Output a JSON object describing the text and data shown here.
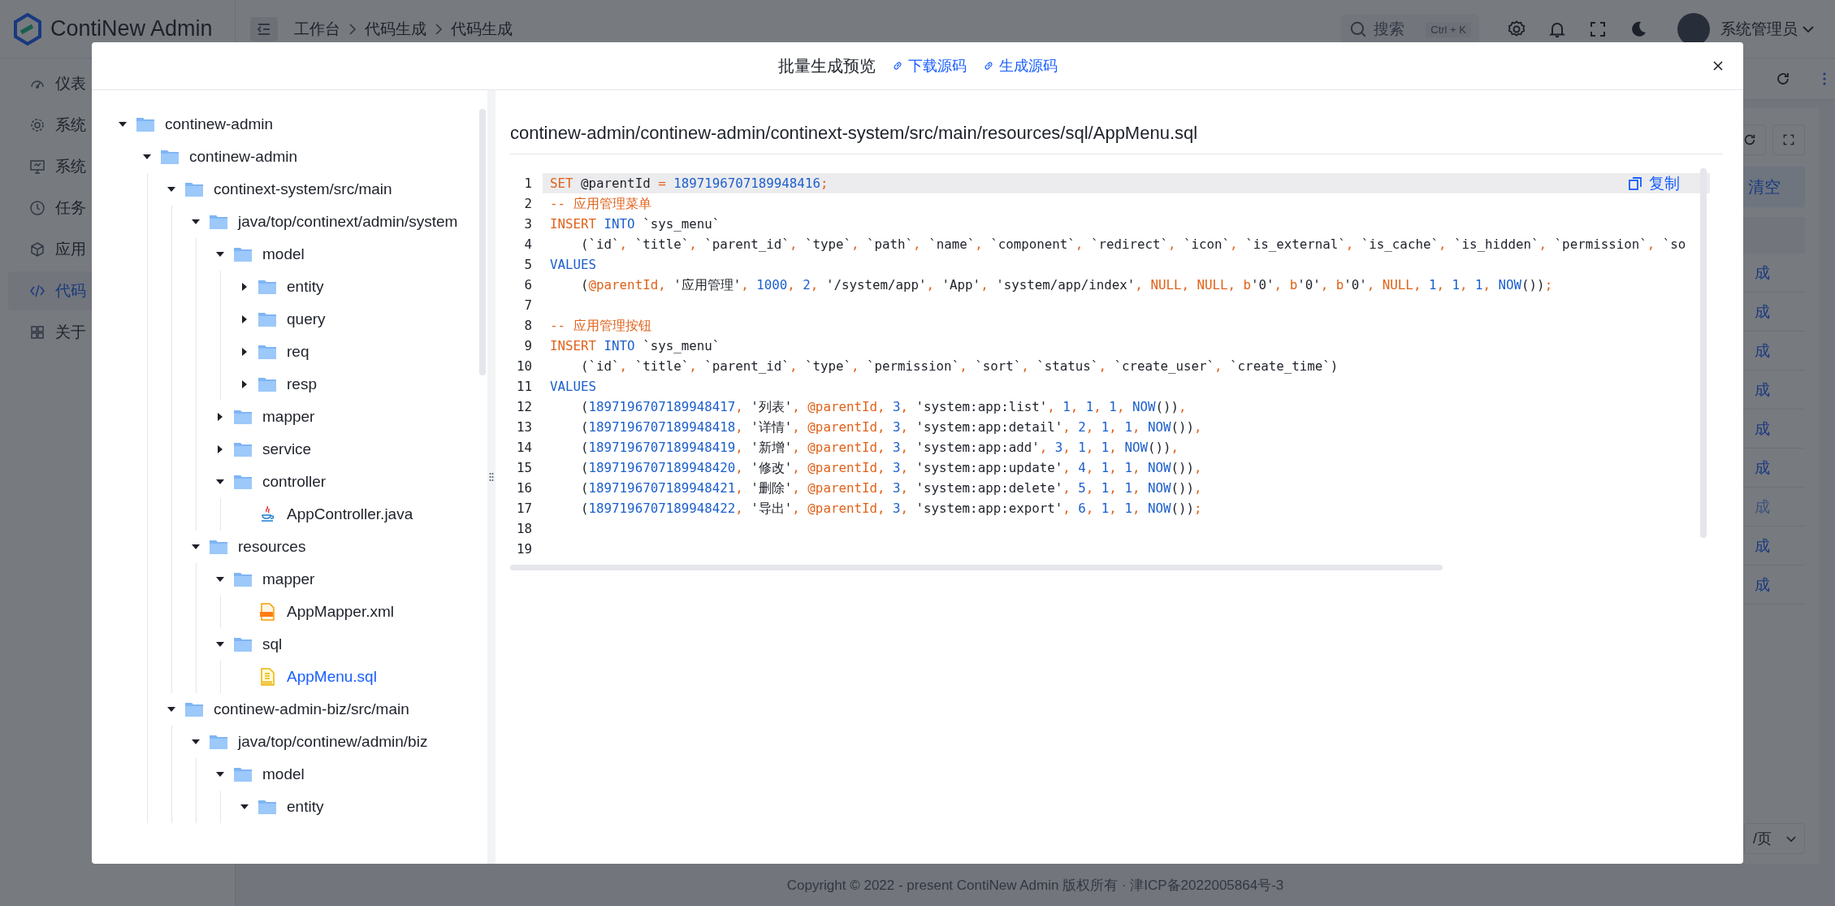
{
  "header": {
    "logo": "ContiNew Admin",
    "breadcrumb": [
      "工作台",
      "代码生成",
      "代码生成"
    ],
    "search": {
      "placeholder": "搜索",
      "shortcut": "Ctrl + K"
    },
    "user": "系统管理员"
  },
  "sidebar": {
    "items": [
      {
        "label": "仪表",
        "selected": false
      },
      {
        "label": "系统",
        "selected": false
      },
      {
        "label": "系统",
        "selected": false
      },
      {
        "label": "任务",
        "selected": false
      },
      {
        "label": "应用",
        "selected": false
      },
      {
        "label": "代码",
        "selected": true
      },
      {
        "label": "关于",
        "selected": false
      }
    ]
  },
  "page": {
    "clear_button": "清空",
    "rows": [
      {
        "text": "成",
        "disabled": false
      },
      {
        "text": "成",
        "disabled": false
      },
      {
        "text": "成",
        "disabled": false
      },
      {
        "text": "成",
        "disabled": false
      },
      {
        "text": "成",
        "disabled": false
      },
      {
        "text": "成",
        "disabled": false
      },
      {
        "text": "成",
        "disabled": true
      },
      {
        "text": "成",
        "disabled": false
      },
      {
        "text": "成",
        "disabled": false
      }
    ],
    "pagination": "/页",
    "footer": "Copyright © 2022 - present ContiNew Admin 版权所有 · 津ICP备2022005864号-3"
  },
  "modal": {
    "title": "批量生成预览",
    "links": [
      "下载源码",
      "生成源码"
    ],
    "tree": [
      {
        "name": "continew-admin",
        "kind": "folder",
        "expanded": true,
        "selected": false,
        "children": [
          {
            "name": "continew-admin",
            "kind": "folder",
            "expanded": true,
            "selected": false,
            "children": [
              {
                "name": "continext-system/src/main",
                "kind": "folder",
                "expanded": true,
                "selected": false,
                "children": [
                  {
                    "name": "java/top/continext/admin/system",
                    "kind": "folder",
                    "expanded": true,
                    "selected": false,
                    "children": [
                      {
                        "name": "model",
                        "kind": "folder",
                        "expanded": true,
                        "selected": false,
                        "children": [
                          {
                            "name": "entity",
                            "kind": "folder",
                            "expanded": false,
                            "selected": false
                          },
                          {
                            "name": "query",
                            "kind": "folder",
                            "expanded": false,
                            "selected": false
                          },
                          {
                            "name": "req",
                            "kind": "folder",
                            "expanded": false,
                            "selected": false
                          },
                          {
                            "name": "resp",
                            "kind": "folder",
                            "expanded": false,
                            "selected": false
                          }
                        ]
                      },
                      {
                        "name": "mapper",
                        "kind": "folder",
                        "expanded": false,
                        "selected": false
                      },
                      {
                        "name": "service",
                        "kind": "folder",
                        "expanded": false,
                        "selected": false
                      },
                      {
                        "name": "controller",
                        "kind": "folder",
                        "expanded": true,
                        "selected": false,
                        "children": [
                          {
                            "name": "AppController.java",
                            "kind": "java",
                            "selected": false
                          }
                        ]
                      }
                    ]
                  },
                  {
                    "name": "resources",
                    "kind": "folder",
                    "expanded": true,
                    "selected": false,
                    "children": [
                      {
                        "name": "mapper",
                        "kind": "folder",
                        "expanded": true,
                        "selected": false,
                        "children": [
                          {
                            "name": "AppMapper.xml",
                            "kind": "xml",
                            "selected": false
                          }
                        ]
                      },
                      {
                        "name": "sql",
                        "kind": "folder",
                        "expanded": true,
                        "selected": false,
                        "children": [
                          {
                            "name": "AppMenu.sql",
                            "kind": "sql",
                            "selected": true
                          }
                        ]
                      }
                    ]
                  }
                ]
              },
              {
                "name": "continew-admin-biz/src/main",
                "kind": "folder",
                "expanded": true,
                "selected": false,
                "children": [
                  {
                    "name": "java/top/continew/admin/biz",
                    "kind": "folder",
                    "expanded": true,
                    "selected": false,
                    "children": [
                      {
                        "name": "model",
                        "kind": "folder",
                        "expanded": true,
                        "selected": false,
                        "children": [
                          {
                            "name": "entity",
                            "kind": "folder",
                            "expanded": true,
                            "selected": false
                          }
                        ]
                      }
                    ]
                  }
                ]
              }
            ]
          }
        ]
      }
    ],
    "file_path": "continew-admin/continew-admin/continext-system/src/main/resources/sql/AppMenu.sql",
    "copy_button": "复制",
    "code": [
      {
        "no": "1",
        "active": true,
        "tokens": [
          {
            "t": "SET",
            "kind": "keyword"
          },
          {
            "t": " @parentId ",
            "kind": "plain"
          },
          {
            "t": "=",
            "kind": "punct"
          },
          {
            "t": " 1897196707189948416",
            "kind": "number"
          },
          {
            "t": ";",
            "kind": "punct"
          }
        ]
      },
      {
        "no": "2",
        "active": false,
        "tokens": [
          {
            "t": "-- 应用管理菜单",
            "kind": "comment"
          }
        ]
      },
      {
        "no": "3",
        "active": false,
        "tokens": [
          {
            "t": "INSERT",
            "kind": "keyword"
          },
          {
            "t": " INTO",
            "kind": "function"
          },
          {
            "t": " `sys_menu`",
            "kind": "plain"
          }
        ]
      },
      {
        "no": "4",
        "active": false,
        "tokens": [
          {
            "t": "    (`id`",
            "kind": "plain"
          },
          {
            "t": ", ",
            "kind": "punct"
          },
          {
            "t": "`title`",
            "kind": "plain"
          },
          {
            "t": ", ",
            "kind": "punct"
          },
          {
            "t": "`parent_id`",
            "kind": "plain"
          },
          {
            "t": ", ",
            "kind": "punct"
          },
          {
            "t": "`type`",
            "kind": "plain"
          },
          {
            "t": ", ",
            "kind": "punct"
          },
          {
            "t": "`path`",
            "kind": "plain"
          },
          {
            "t": ", ",
            "kind": "punct"
          },
          {
            "t": "`name`",
            "kind": "plain"
          },
          {
            "t": ", ",
            "kind": "punct"
          },
          {
            "t": "`component`",
            "kind": "plain"
          },
          {
            "t": ", ",
            "kind": "punct"
          },
          {
            "t": "`redirect`",
            "kind": "plain"
          },
          {
            "t": ", ",
            "kind": "punct"
          },
          {
            "t": "`icon`",
            "kind": "plain"
          },
          {
            "t": ", ",
            "kind": "punct"
          },
          {
            "t": "`is_external`",
            "kind": "plain"
          },
          {
            "t": ", ",
            "kind": "punct"
          },
          {
            "t": "`is_cache`",
            "kind": "plain"
          },
          {
            "t": ", ",
            "kind": "punct"
          },
          {
            "t": "`is_hidden`",
            "kind": "plain"
          },
          {
            "t": ", ",
            "kind": "punct"
          },
          {
            "t": "`permission`",
            "kind": "plain"
          },
          {
            "t": ", ",
            "kind": "punct"
          },
          {
            "t": "`so",
            "kind": "plain"
          }
        ]
      },
      {
        "no": "5",
        "active": false,
        "tokens": [
          {
            "t": "VALUES",
            "kind": "function"
          }
        ]
      },
      {
        "no": "6",
        "active": false,
        "tokens": [
          {
            "t": "    (",
            "kind": "plain"
          },
          {
            "t": "@parentId",
            "kind": "variable"
          },
          {
            "t": ", ",
            "kind": "punct"
          },
          {
            "t": "'应用管理'",
            "kind": "string"
          },
          {
            "t": ", ",
            "kind": "punct"
          },
          {
            "t": "1000",
            "kind": "number"
          },
          {
            "t": ", ",
            "kind": "punct"
          },
          {
            "t": "2",
            "kind": "number"
          },
          {
            "t": ", ",
            "kind": "punct"
          },
          {
            "t": "'/system/app'",
            "kind": "string"
          },
          {
            "t": ", ",
            "kind": "punct"
          },
          {
            "t": "'App'",
            "kind": "string"
          },
          {
            "t": ", ",
            "kind": "punct"
          },
          {
            "t": "'system/app/index'",
            "kind": "string"
          },
          {
            "t": ", ",
            "kind": "punct"
          },
          {
            "t": "NULL",
            "kind": "keyword"
          },
          {
            "t": ", ",
            "kind": "punct"
          },
          {
            "t": "NULL",
            "kind": "keyword"
          },
          {
            "t": ", ",
            "kind": "punct"
          },
          {
            "t": "b",
            "kind": "keyword"
          },
          {
            "t": "'0'",
            "kind": "string"
          },
          {
            "t": ", ",
            "kind": "punct"
          },
          {
            "t": "b",
            "kind": "keyword"
          },
          {
            "t": "'0'",
            "kind": "string"
          },
          {
            "t": ", ",
            "kind": "punct"
          },
          {
            "t": "b",
            "kind": "keyword"
          },
          {
            "t": "'0'",
            "kind": "string"
          },
          {
            "t": ", ",
            "kind": "punct"
          },
          {
            "t": "NULL",
            "kind": "keyword"
          },
          {
            "t": ", ",
            "kind": "punct"
          },
          {
            "t": "1",
            "kind": "number"
          },
          {
            "t": ", ",
            "kind": "punct"
          },
          {
            "t": "1",
            "kind": "number"
          },
          {
            "t": ", ",
            "kind": "punct"
          },
          {
            "t": "1",
            "kind": "number"
          },
          {
            "t": ", ",
            "kind": "punct"
          },
          {
            "t": "NOW",
            "kind": "function"
          },
          {
            "t": "())",
            "kind": "plain"
          },
          {
            "t": ";",
            "kind": "punct"
          }
        ]
      },
      {
        "no": "7",
        "active": false
      },
      {
        "no": "8",
        "active": false,
        "tokens": [
          {
            "t": "-- 应用管理按钮",
            "kind": "comment"
          }
        ]
      },
      {
        "no": "9",
        "active": false,
        "tokens": [
          {
            "t": "INSERT",
            "kind": "keyword"
          },
          {
            "t": " INTO",
            "kind": "function"
          },
          {
            "t": " `sys_menu`",
            "kind": "plain"
          }
        ]
      },
      {
        "no": "10",
        "active": false,
        "tokens": [
          {
            "t": "    (`id`",
            "kind": "plain"
          },
          {
            "t": ", ",
            "kind": "punct"
          },
          {
            "t": "`title`",
            "kind": "plain"
          },
          {
            "t": ", ",
            "kind": "punct"
          },
          {
            "t": "`parent_id`",
            "kind": "plain"
          },
          {
            "t": ", ",
            "kind": "punct"
          },
          {
            "t": "`type`",
            "kind": "plain"
          },
          {
            "t": ", ",
            "kind": "punct"
          },
          {
            "t": "`permission`",
            "kind": "plain"
          },
          {
            "t": ", ",
            "kind": "punct"
          },
          {
            "t": "`sort`",
            "kind": "plain"
          },
          {
            "t": ", ",
            "kind": "punct"
          },
          {
            "t": "`status`",
            "kind": "plain"
          },
          {
            "t": ", ",
            "kind": "punct"
          },
          {
            "t": "`create_user`",
            "kind": "plain"
          },
          {
            "t": ", ",
            "kind": "punct"
          },
          {
            "t": "`create_time`)",
            "kind": "plain"
          }
        ]
      },
      {
        "no": "11",
        "active": false,
        "tokens": [
          {
            "t": "VALUES",
            "kind": "function"
          }
        ]
      },
      {
        "no": "12",
        "active": false,
        "tokens": [
          {
            "t": "    (",
            "kind": "plain"
          },
          {
            "t": "1897196707189948417",
            "kind": "number"
          },
          {
            "t": ", ",
            "kind": "punct"
          },
          {
            "t": "'列表'",
            "kind": "string"
          },
          {
            "t": ", ",
            "kind": "punct"
          },
          {
            "t": "@parentId",
            "kind": "variable"
          },
          {
            "t": ", ",
            "kind": "punct"
          },
          {
            "t": "3",
            "kind": "number"
          },
          {
            "t": ", ",
            "kind": "punct"
          },
          {
            "t": "'system:app:list'",
            "kind": "string"
          },
          {
            "t": ", ",
            "kind": "punct"
          },
          {
            "t": "1",
            "kind": "number"
          },
          {
            "t": ", ",
            "kind": "punct"
          },
          {
            "t": "1",
            "kind": "number"
          },
          {
            "t": ", ",
            "kind": "punct"
          },
          {
            "t": "1",
            "kind": "number"
          },
          {
            "t": ", ",
            "kind": "punct"
          },
          {
            "t": "NOW",
            "kind": "function"
          },
          {
            "t": "())",
            "kind": "plain"
          },
          {
            "t": ",",
            "kind": "punct"
          }
        ]
      },
      {
        "no": "13",
        "active": false,
        "tokens": [
          {
            "t": "    (",
            "kind": "plain"
          },
          {
            "t": "1897196707189948418",
            "kind": "number"
          },
          {
            "t": ", ",
            "kind": "punct"
          },
          {
            "t": "'详情'",
            "kind": "string"
          },
          {
            "t": ", ",
            "kind": "punct"
          },
          {
            "t": "@parentId",
            "kind": "variable"
          },
          {
            "t": ", ",
            "kind": "punct"
          },
          {
            "t": "3",
            "kind": "number"
          },
          {
            "t": ", ",
            "kind": "punct"
          },
          {
            "t": "'system:app:detail'",
            "kind": "string"
          },
          {
            "t": ", ",
            "kind": "punct"
          },
          {
            "t": "2",
            "kind": "number"
          },
          {
            "t": ", ",
            "kind": "punct"
          },
          {
            "t": "1",
            "kind": "number"
          },
          {
            "t": ", ",
            "kind": "punct"
          },
          {
            "t": "1",
            "kind": "number"
          },
          {
            "t": ", ",
            "kind": "punct"
          },
          {
            "t": "NOW",
            "kind": "function"
          },
          {
            "t": "())",
            "kind": "plain"
          },
          {
            "t": ",",
            "kind": "punct"
          }
        ]
      },
      {
        "no": "14",
        "active": false,
        "tokens": [
          {
            "t": "    (",
            "kind": "plain"
          },
          {
            "t": "1897196707189948419",
            "kind": "number"
          },
          {
            "t": ", ",
            "kind": "punct"
          },
          {
            "t": "'新增'",
            "kind": "string"
          },
          {
            "t": ", ",
            "kind": "punct"
          },
          {
            "t": "@parentId",
            "kind": "variable"
          },
          {
            "t": ", ",
            "kind": "punct"
          },
          {
            "t": "3",
            "kind": "number"
          },
          {
            "t": ", ",
            "kind": "punct"
          },
          {
            "t": "'system:app:add'",
            "kind": "string"
          },
          {
            "t": ", ",
            "kind": "punct"
          },
          {
            "t": "3",
            "kind": "number"
          },
          {
            "t": ", ",
            "kind": "punct"
          },
          {
            "t": "1",
            "kind": "number"
          },
          {
            "t": ", ",
            "kind": "punct"
          },
          {
            "t": "1",
            "kind": "number"
          },
          {
            "t": ", ",
            "kind": "punct"
          },
          {
            "t": "NOW",
            "kind": "function"
          },
          {
            "t": "())",
            "kind": "plain"
          },
          {
            "t": ",",
            "kind": "punct"
          }
        ]
      },
      {
        "no": "15",
        "active": false,
        "tokens": [
          {
            "t": "    (",
            "kind": "plain"
          },
          {
            "t": "1897196707189948420",
            "kind": "number"
          },
          {
            "t": ", ",
            "kind": "punct"
          },
          {
            "t": "'修改'",
            "kind": "string"
          },
          {
            "t": ", ",
            "kind": "punct"
          },
          {
            "t": "@parentId",
            "kind": "variable"
          },
          {
            "t": ", ",
            "kind": "punct"
          },
          {
            "t": "3",
            "kind": "number"
          },
          {
            "t": ", ",
            "kind": "punct"
          },
          {
            "t": "'system:app:update'",
            "kind": "string"
          },
          {
            "t": ", ",
            "kind": "punct"
          },
          {
            "t": "4",
            "kind": "number"
          },
          {
            "t": ", ",
            "kind": "punct"
          },
          {
            "t": "1",
            "kind": "number"
          },
          {
            "t": ", ",
            "kind": "punct"
          },
          {
            "t": "1",
            "kind": "number"
          },
          {
            "t": ", ",
            "kind": "punct"
          },
          {
            "t": "NOW",
            "kind": "function"
          },
          {
            "t": "())",
            "kind": "plain"
          },
          {
            "t": ",",
            "kind": "punct"
          }
        ]
      },
      {
        "no": "16",
        "active": false,
        "tokens": [
          {
            "t": "    (",
            "kind": "plain"
          },
          {
            "t": "1897196707189948421",
            "kind": "number"
          },
          {
            "t": ", ",
            "kind": "punct"
          },
          {
            "t": "'删除'",
            "kind": "string"
          },
          {
            "t": ", ",
            "kind": "punct"
          },
          {
            "t": "@parentId",
            "kind": "variable"
          },
          {
            "t": ", ",
            "kind": "punct"
          },
          {
            "t": "3",
            "kind": "number"
          },
          {
            "t": ", ",
            "kind": "punct"
          },
          {
            "t": "'system:app:delete'",
            "kind": "string"
          },
          {
            "t": ", ",
            "kind": "punct"
          },
          {
            "t": "5",
            "kind": "number"
          },
          {
            "t": ", ",
            "kind": "punct"
          },
          {
            "t": "1",
            "kind": "number"
          },
          {
            "t": ", ",
            "kind": "punct"
          },
          {
            "t": "1",
            "kind": "number"
          },
          {
            "t": ", ",
            "kind": "punct"
          },
          {
            "t": "NOW",
            "kind": "function"
          },
          {
            "t": "())",
            "kind": "plain"
          },
          {
            "t": ",",
            "kind": "punct"
          }
        ]
      },
      {
        "no": "17",
        "active": false,
        "tokens": [
          {
            "t": "    (",
            "kind": "plain"
          },
          {
            "t": "1897196707189948422",
            "kind": "number"
          },
          {
            "t": ", ",
            "kind": "punct"
          },
          {
            "t": "'导出'",
            "kind": "string"
          },
          {
            "t": ", ",
            "kind": "punct"
          },
          {
            "t": "@parentId",
            "kind": "variable"
          },
          {
            "t": ", ",
            "kind": "punct"
          },
          {
            "t": "3",
            "kind": "number"
          },
          {
            "t": ", ",
            "kind": "punct"
          },
          {
            "t": "'system:app:export'",
            "kind": "string"
          },
          {
            "t": ", ",
            "kind": "punct"
          },
          {
            "t": "6",
            "kind": "number"
          },
          {
            "t": ", ",
            "kind": "punct"
          },
          {
            "t": "1",
            "kind": "number"
          },
          {
            "t": ", ",
            "kind": "punct"
          },
          {
            "t": "1",
            "kind": "number"
          },
          {
            "t": ", ",
            "kind": "punct"
          },
          {
            "t": "NOW",
            "kind": "function"
          },
          {
            "t": "())",
            "kind": "plain"
          },
          {
            "t": ";",
            "kind": "punct"
          }
        ]
      },
      {
        "no": "18",
        "active": false
      },
      {
        "no": "19",
        "active": false
      }
    ]
  }
}
